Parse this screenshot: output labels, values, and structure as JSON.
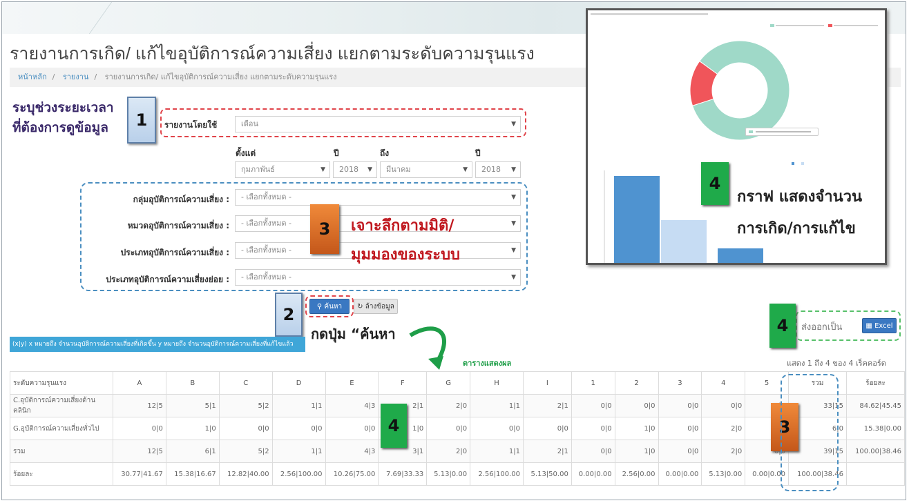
{
  "page": {
    "title": "รายงานการเกิด/ แก้ไขอุบัติการณ์ความเสี่ยง แยกตามระดับความรุนแรง",
    "breadcrumb": [
      "หน้าหลัก",
      "รายงาน",
      "รายงานการเกิด/ แก้ไขอุบัติการณ์ความเสี่ยง แยกตามระดับความรุนแรง"
    ]
  },
  "annotations": {
    "step1_text": [
      "ระบุช่วงระยะเวลา",
      "ที่ต้องการดูข้อมูล"
    ],
    "step1_num": "1",
    "step2_num": "2",
    "step2_text": "กดปุ่ม “ค้นหา",
    "step3_num": "3",
    "step3_text": [
      "เจาะลึกตามมิติ/",
      "มุมมองของระบบ"
    ],
    "step4_num": "4",
    "graph_text": [
      "กราฟ แสดงจำนวน",
      "การเกิด/การแก้ไข"
    ],
    "result_label": "ตารางแสดงผล"
  },
  "form": {
    "report_by_label": "รายงานโดยใช้",
    "report_by_value": "เดือน",
    "from_label": "ตั้งแต่",
    "year_label": "ปี",
    "to_label": "ถึง",
    "year2_label": "ปี",
    "from_month": "กุมภาพันธ์",
    "from_year": "2018",
    "to_month": "มีนาคม",
    "to_year": "2018",
    "filters": [
      {
        "label": "กลุ่มอุบัติการณ์ความเสี่ยง :",
        "value": "- เลือกทั้งหมด -"
      },
      {
        "label": "หมวดอุบัติการณ์ความเสี่ยง :",
        "value": "- เลือกทั้งหมด -"
      },
      {
        "label": "ประเภทอุบัติการณ์ความเสี่ยง :",
        "value": "- เลือกทั้งหมด -"
      },
      {
        "label": "ประเภทอุบัติการณ์ความเสี่ยงย่อย :",
        "value": "- เลือกทั้งหมด -"
      }
    ],
    "search_button": "ค้นหา",
    "clear_button": "ล้างข้อมูล"
  },
  "export": {
    "label": "ส่งออกเป็น",
    "button": "Excel"
  },
  "info_bar": "(x|y) x หมายถึง จำนวนอุบัติการณ์ความเสี่ยงที่เกิดขึ้น y หมายถึง จำนวนอุบัติการณ์ความเสี่ยงที่แก้ไขแล้ว",
  "table_info": "แสดง 1 ถึง 4 ของ 4 เร็คคอร์ด",
  "table": {
    "headers": [
      "ระดับความรุนแรง",
      "A",
      "B",
      "C",
      "D",
      "E",
      "F",
      "G",
      "H",
      "I",
      "1",
      "2",
      "3",
      "4",
      "5",
      "รวม",
      "ร้อยละ"
    ],
    "rows": [
      [
        "C.อุบัติการณ์ความเสี่ยงด้านคลินิก",
        "12|5",
        "5|1",
        "5|2",
        "1|1",
        "4|3",
        "2|1",
        "2|0",
        "1|1",
        "2|1",
        "0|0",
        "0|0",
        "0|0",
        "0|0",
        "0|0",
        "33|15",
        "84.62|45.45"
      ],
      [
        "G.อุบัติการณ์ความเสี่ยงทั่วไป",
        "0|0",
        "1|0",
        "0|0",
        "0|0",
        "0|0",
        "1|0",
        "0|0",
        "0|0",
        "0|0",
        "0|0",
        "1|0",
        "0|0",
        "2|0",
        "0|0",
        "6|0",
        "15.38|0.00"
      ],
      [
        "รวม",
        "12|5",
        "6|1",
        "5|2",
        "1|1",
        "4|3",
        "3|1",
        "2|0",
        "1|1",
        "2|1",
        "0|0",
        "1|0",
        "0|0",
        "2|0",
        "0|0",
        "39|15",
        "100.00|38.46"
      ],
      [
        "ร้อยละ",
        "30.77|41.67",
        "15.38|16.67",
        "12.82|40.00",
        "2.56|100.00",
        "10.26|75.00",
        "7.69|33.33",
        "5.13|0.00",
        "2.56|100.00",
        "5.13|50.00",
        "0.00|0.00",
        "2.56|0.00",
        "0.00|0.00",
        "5.13|0.00",
        "0.00|0.00",
        "100.00|38.46",
        ""
      ]
    ]
  },
  "colors": {
    "donut_main": "#9fd9c8",
    "donut_slice": "#f0555a",
    "bar_dark": "#4f93d0",
    "bar_light": "#c6dcf3",
    "step_green": "#1faa4a",
    "step_orange": "#d9672a"
  },
  "chart_data": {
    "type": "pie",
    "donut": {
      "slices": [
        {
          "value": 85,
          "color": "#9fd9c8"
        },
        {
          "value": 15,
          "color": "#f0555a"
        }
      ]
    },
    "bars": {
      "type": "bar",
      "values": [
        100,
        50,
        18
      ],
      "ylim": [
        0,
        100
      ]
    }
  }
}
